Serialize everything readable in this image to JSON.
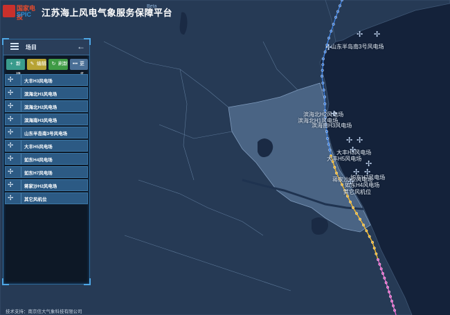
{
  "app": {
    "logo_cn": "国家电投",
    "logo_en": "SPIC",
    "title": "江苏海上风电气象服务保障平台",
    "beta": "Beta"
  },
  "panel": {
    "title": "场目",
    "back_icon": "arrow-left-icon",
    "toolbar": [
      {
        "label": "新建",
        "icon": "plus-icon",
        "color": "#3a9b8c"
      },
      {
        "label": "编辑",
        "icon": "edit-icon",
        "color": "#b7a334"
      },
      {
        "label": "刷新",
        "icon": "refresh-icon",
        "color": "#3f9b45"
      },
      {
        "label": "更多",
        "icon": "more-icon",
        "color": "#4a6f96"
      }
    ],
    "items": [
      {
        "label": "大丰H3风电场",
        "icon": "wind-turbine-icon"
      },
      {
        "label": "滨海北H1风电场",
        "icon": "wind-turbine-icon"
      },
      {
        "label": "滨海北H2风电场",
        "icon": "wind-turbine-icon"
      },
      {
        "label": "滨海南H3风电场",
        "icon": "wind-turbine-icon"
      },
      {
        "label": "山东半岛南3号风电场",
        "icon": "wind-turbine-icon"
      },
      {
        "label": "大丰H5风电场",
        "icon": "wind-turbine-icon"
      },
      {
        "label": "如东H4风电场",
        "icon": "wind-turbine-icon"
      },
      {
        "label": "如东H7风电场",
        "icon": "wind-turbine-icon"
      },
      {
        "label": "蒋家沙H2风电场",
        "icon": "wind-turbine-icon"
      },
      {
        "label": "其它风机位",
        "icon": "wind-turbine-icon"
      }
    ]
  },
  "map": {
    "labels": [
      "山东半岛南3号风电场",
      "滨海北H2风电场",
      "滨海北H1风电场",
      "滨海南H3风电场",
      "大丰H3风电场",
      "大丰H5风电场",
      "如东H7风电场",
      "如东H4风电场",
      "蒋家沙H2风电场",
      "其它风机位"
    ],
    "colors": {
      "sea": "#14223a",
      "land": "#263a55",
      "jiangsu": "#4a6484",
      "track_blue": "#3b7ddb",
      "track_yellow": "#f2b72a",
      "track_pink": "#e45fc8"
    }
  },
  "footer": {
    "text": "技术支持：南京信大气象科技有限公司"
  }
}
